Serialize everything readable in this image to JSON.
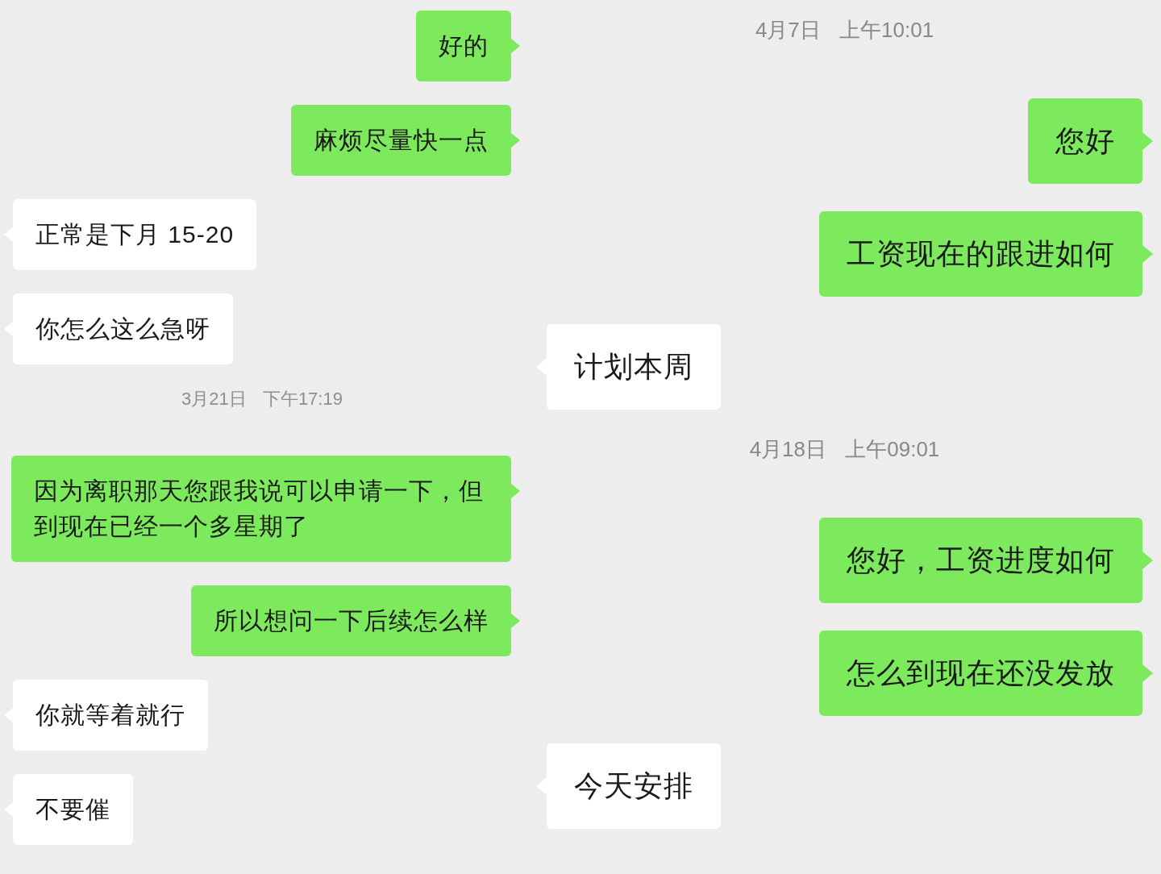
{
  "panels": [
    {
      "messages": [
        {
          "kind": "sent",
          "text": "好的"
        },
        {
          "kind": "sent",
          "text": "麻烦尽量快一点"
        },
        {
          "kind": "received",
          "text": "正常是下月 15-20"
        },
        {
          "kind": "received",
          "text": "你怎么这么急呀"
        },
        {
          "kind": "time",
          "text": "3月21日 下午17:19"
        },
        {
          "kind": "sent",
          "text": "因为离职那天您跟我说可以申请一下，但到现在已经一个多星期了"
        },
        {
          "kind": "sent",
          "text": "所以想问一下后续怎么样"
        },
        {
          "kind": "received",
          "text": "你就等着就行"
        },
        {
          "kind": "received",
          "text": "不要催"
        }
      ]
    },
    {
      "messages": [
        {
          "kind": "time",
          "text": "4月7日 上午10:01"
        },
        {
          "kind": "sent",
          "text": "您好"
        },
        {
          "kind": "sent",
          "text": "工资现在的跟进如何"
        },
        {
          "kind": "received",
          "text": "计划本周"
        },
        {
          "kind": "time",
          "text": "4月18日 上午09:01"
        },
        {
          "kind": "sent",
          "text": "您好，工资进度如何"
        },
        {
          "kind": "sent",
          "text": "怎么到现在还没发放"
        },
        {
          "kind": "received",
          "text": "今天安排"
        }
      ]
    }
  ]
}
